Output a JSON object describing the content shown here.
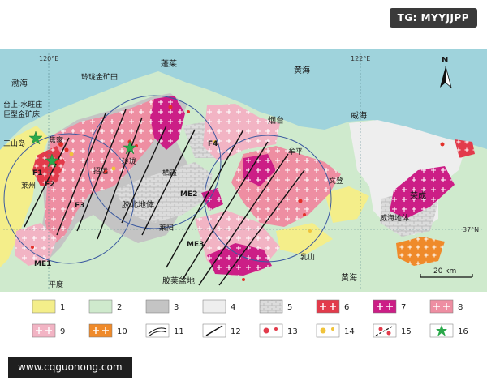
{
  "watermark_badge": "TG: MYYJJPP",
  "website_banner": "www.cqguonong.com",
  "map": {
    "colors": {
      "sea": "#9fd3dc",
      "unit1": "#f4ee8a",
      "unit2": "#cfeacd",
      "unit3": "#c4c4c4",
      "unit4": "#eeeeee",
      "unit5": "#d8d8d8",
      "unit6": "#e23b4b",
      "unit7": "#cc1e86",
      "unit8": "#ee8ea2",
      "unit9": "#f2b4c4",
      "unit10": "#ef8a2a",
      "star": "#2aa84a"
    },
    "coords": {
      "lon_120": "120°E",
      "lon_122": "122°E",
      "lat_37": "37°N"
    },
    "north_label": "N",
    "scale_label": "20 km",
    "labels": {
      "bohai": "渤海",
      "huanghai_north": "黄海",
      "huanghai_south": "黄海",
      "penglai": "蓬莱",
      "linglong_field": "玲珑金矿田",
      "yantai": "烟台",
      "weihai": "威海",
      "taishang_line1": "台上-水旺庄",
      "taishang_line2": "巨型金矿床",
      "sanshandao": "三山岛",
      "jiaojia": "焦家",
      "zhaoyuan": "招远",
      "linglong": "玲珑",
      "qixia": "栖霞",
      "muping": "牟平",
      "wendeng": "文登",
      "rongcheng": "荣成",
      "weihai_block": "威海地体",
      "jiaobei_block": "胶北地体",
      "laizhou": "莱州",
      "laiyang": "莱阳",
      "jiaolai_basin": "胶莱盆地",
      "rushan": "乳山",
      "pingdu": "平度",
      "F1": "F1",
      "F2": "F2",
      "F3": "F3",
      "F4": "F4",
      "ME1": "ME1",
      "ME2": "ME2",
      "ME3": "ME3"
    }
  },
  "legend": {
    "items": [
      {
        "num": "1",
        "icon": "yellow-fill"
      },
      {
        "num": "2",
        "icon": "pale-green-fill"
      },
      {
        "num": "3",
        "icon": "gray-fill"
      },
      {
        "num": "4",
        "icon": "light-gray-fill"
      },
      {
        "num": "5",
        "icon": "brick-hatch-fill"
      },
      {
        "num": "6",
        "icon": "red-crosses"
      },
      {
        "num": "7",
        "icon": "magenta-crosses"
      },
      {
        "num": "8",
        "icon": "pink-crosses"
      },
      {
        "num": "9",
        "icon": "light-pink-crosses"
      },
      {
        "num": "10",
        "icon": "orange-crosses"
      },
      {
        "num": "11",
        "icon": "curved-lines"
      },
      {
        "num": "12",
        "icon": "straight-line"
      },
      {
        "num": "13",
        "icon": "red-dots"
      },
      {
        "num": "14",
        "icon": "yellow-dots"
      },
      {
        "num": "15",
        "icon": "red-dots-dashed-fault"
      },
      {
        "num": "16",
        "icon": "green-star"
      }
    ]
  }
}
